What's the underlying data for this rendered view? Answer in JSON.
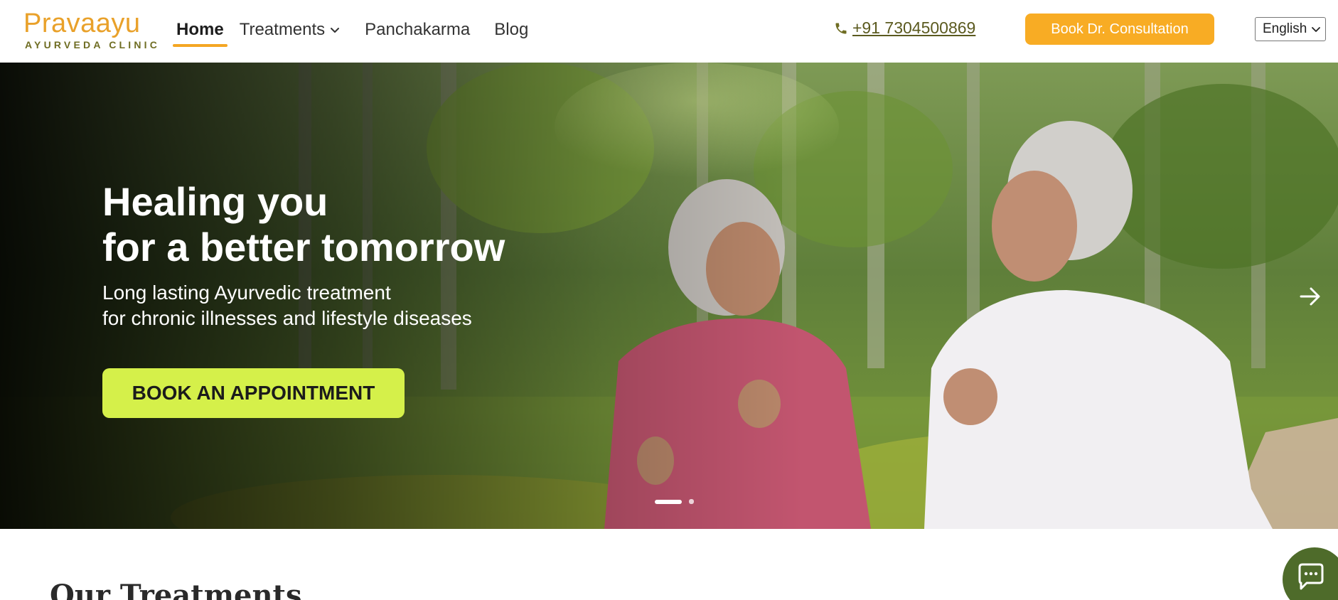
{
  "brand": {
    "name": "Pravaayu",
    "tagline": "AYURVEDA CLINIC",
    "primary_color": "#f4a623",
    "secondary_color": "#6f6d23"
  },
  "nav": {
    "items": [
      {
        "label": "Home",
        "active": true
      },
      {
        "label": "Treatments",
        "has_dropdown": true
      },
      {
        "label": "Panchakarma"
      },
      {
        "label": "Blog"
      }
    ]
  },
  "header": {
    "phone": "+91 7304500869",
    "cta_label": "Book Dr. Consultation",
    "language": "English"
  },
  "hero": {
    "title_line1": "Healing you",
    "title_line2": "for a better tomorrow",
    "subtitle_line1": "Long lasting Ayurvedic treatment",
    "subtitle_line2": "for chronic illnesses and lifestyle diseases",
    "button_label": "BOOK AN APPOINTMENT",
    "button_color": "#d5f04a",
    "slide_count": 2,
    "active_slide": 1
  },
  "section": {
    "title": "Our Treatments"
  },
  "icons": {
    "phone": "phone-icon",
    "chevron": "chevron-down-icon",
    "next": "arrow-right-icon",
    "chat": "chat-icon"
  }
}
